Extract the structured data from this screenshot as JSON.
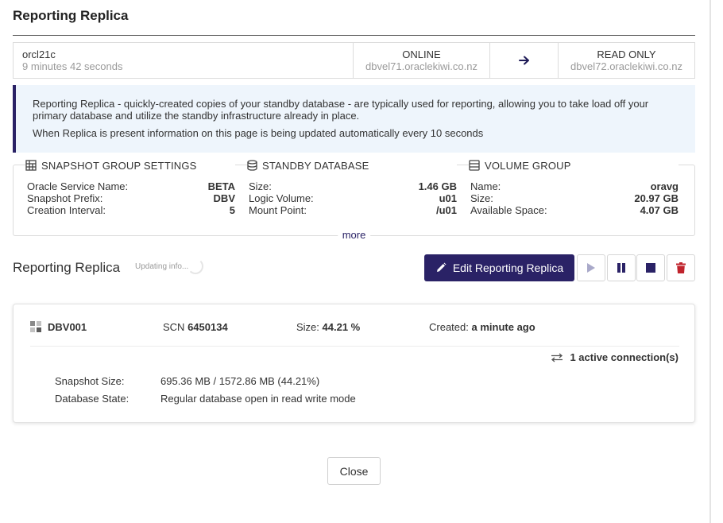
{
  "dialog": {
    "title": "Reporting Replica"
  },
  "status_bar": {
    "database": "orcl21c",
    "elapsed": "9 minutes 42 seconds",
    "source_state": "ONLINE",
    "source_host": "dbvel71.oraclekiwi.co.nz",
    "arrow_icon": "arrow-right-icon",
    "target_state": "READ ONLY",
    "target_host": "dbvel72.oraclekiwi.co.nz"
  },
  "info": {
    "line1": "Reporting Replica - quickly-created copies of your standby database - are typically used for reporting, allowing you to take load off your primary database and utilize the standby infrastructure already in place.",
    "line2": "When Replica is present information on this page is being updated automatically every 10 seconds"
  },
  "settings": {
    "snapshot_group": {
      "title": "SNAPSHOT GROUP SETTINGS",
      "icon": "grid-table-icon",
      "rows": [
        {
          "key": "Oracle Service Name:",
          "value": "BETA"
        },
        {
          "key": "Snapshot Prefix:",
          "value": "DBV"
        },
        {
          "key": "Creation Interval:",
          "value": "5"
        }
      ]
    },
    "standby_database": {
      "title": "STANDBY DATABASE",
      "icon": "database-icon",
      "rows": [
        {
          "key": "Size:",
          "value": "1.46 GB"
        },
        {
          "key": "Logic Volume:",
          "value": "u01"
        },
        {
          "key": "Mount Point:",
          "value": "/u01"
        }
      ]
    },
    "volume_group": {
      "title": "VOLUME GROUP",
      "icon": "server-rack-icon",
      "rows": [
        {
          "key": "Name:",
          "value": "oravg"
        },
        {
          "key": "Size:",
          "value": "20.97 GB"
        },
        {
          "key": "Available Space:",
          "value": "4.07 GB"
        }
      ]
    },
    "more_label": "more"
  },
  "replica_section": {
    "heading": "Reporting Replica",
    "updating_text": "Updating info...",
    "edit_label": "Edit Reporting Replica"
  },
  "snapshot": {
    "name": "DBV001",
    "scn_label": "SCN",
    "scn_value": "6450134",
    "size_label": "Size:",
    "size_value": "44.21 %",
    "created_label": "Created:",
    "created_value": "a minute ago",
    "connections": "1 active connection(s)",
    "snapshot_size_label": "Snapshot Size:",
    "snapshot_size_value": "695.36 MB / 1572.86 MB (44.21%)",
    "db_state_label": "Database State:",
    "db_state_value": "Regular database open in read write mode"
  },
  "footer": {
    "close_label": "Close"
  },
  "colors": {
    "accent": "#2a2266",
    "info_bg": "#eef5fc",
    "delete": "#c0232c",
    "disabled": "#a9a9c9"
  }
}
